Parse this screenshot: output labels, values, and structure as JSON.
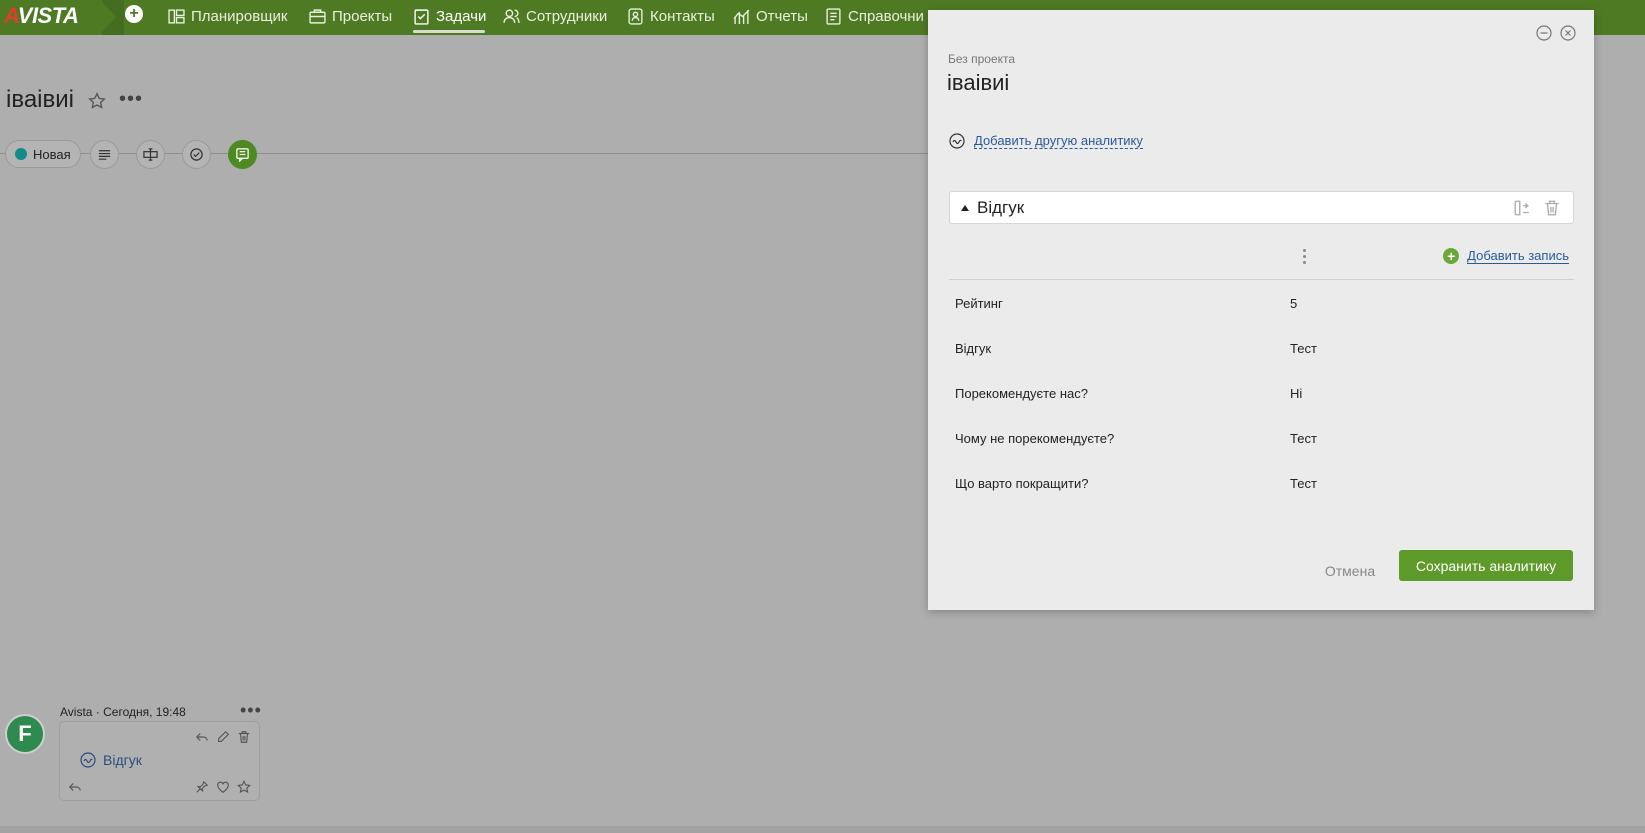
{
  "app": {
    "logo": "AVISTA",
    "colors": {
      "brand_green": "#4e7a24",
      "accent_green": "#5e9a2a",
      "status_teal": "#148a8a",
      "link_blue": "#2b5a9a"
    }
  },
  "nav": {
    "items": [
      {
        "label": "Планировщик",
        "icon": "calendar-icon"
      },
      {
        "label": "Проекты",
        "icon": "briefcase-icon"
      },
      {
        "label": "Задачи",
        "icon": "checklist-icon",
        "active": true
      },
      {
        "label": "Сотрудники",
        "icon": "people-icon"
      },
      {
        "label": "Контакты",
        "icon": "contact-icon"
      },
      {
        "label": "Отчеты",
        "icon": "chart-icon"
      },
      {
        "label": "Справочни",
        "icon": "book-icon"
      }
    ]
  },
  "task": {
    "title": "іваівиі",
    "status": "Новая"
  },
  "comment": {
    "author": "Avista",
    "time": "Сегодня, 19:48",
    "link_text": "Відгук"
  },
  "dialog": {
    "project": "Без проекта",
    "title": "іваівиі",
    "add_analytics_label": "Добавить другую аналитику",
    "section_title": "Відгук",
    "add_record_label": "Добавить запись",
    "records": [
      {
        "label": "Рейтинг",
        "value": "5"
      },
      {
        "label": "Відгук",
        "value": "Тест"
      },
      {
        "label": "Порекомендуєте нас?",
        "value": "Ні"
      },
      {
        "label": "Чому не порекомендуєте?",
        "value": "Тест"
      },
      {
        "label": "Що варто покращити?",
        "value": "Тест"
      }
    ],
    "cancel_label": "Отмена",
    "save_label": "Сохранить аналитику"
  }
}
